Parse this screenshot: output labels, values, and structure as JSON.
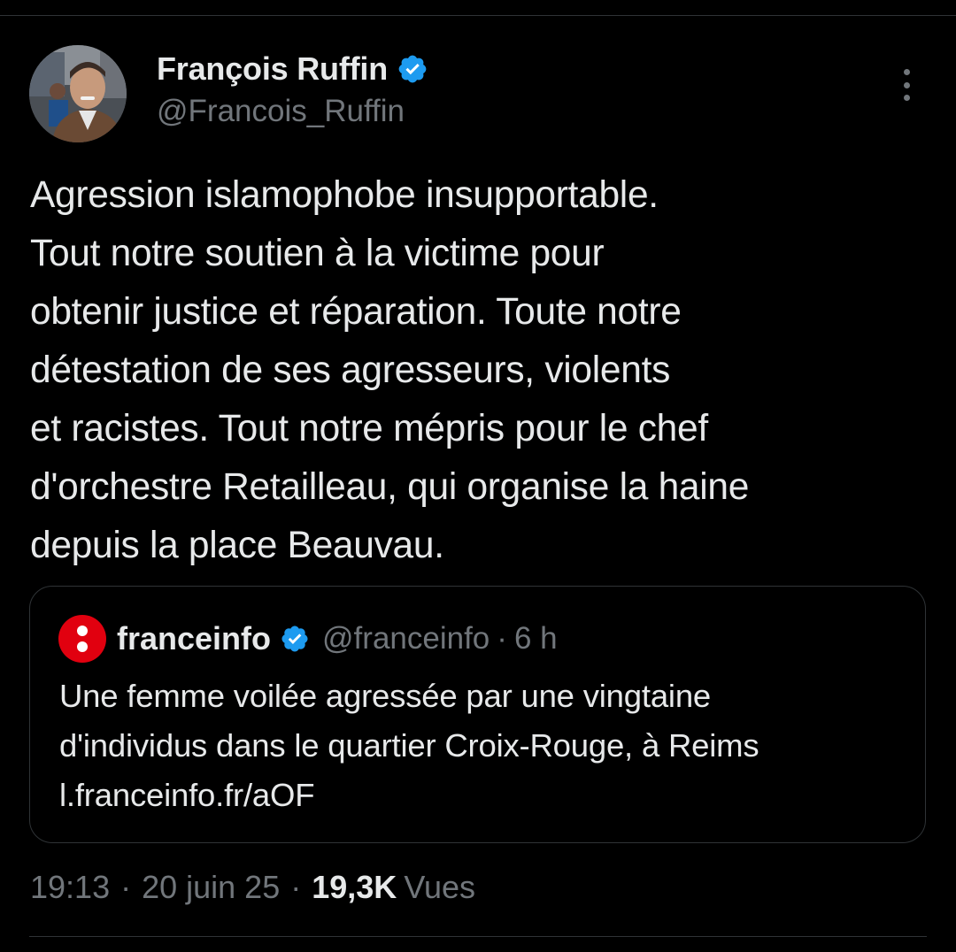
{
  "tweet": {
    "author": {
      "display_name": "François Ruffin",
      "handle": "@Francois_Ruffin",
      "verified": true
    },
    "text": "Agression islamophobe insupportable.\nTout notre soutien à la victime pour\nobtenir justice et réparation. Toute notre\ndétestation de ses agresseurs, violents\net racistes. Tout notre mépris pour le chef\nd'orchestre Retailleau, qui organise la haine\ndepuis la place Beauvau.",
    "quote": {
      "display_name": "franceinfo",
      "handle": "@franceinfo",
      "separator": "·",
      "time": "6 h",
      "text": "Une femme voilée agressée par une vingtaine\nd'individus dans le quartier Croix-Rouge, à Reims\nl.franceinfo.fr/aOF",
      "logo_color": "#e1000f"
    },
    "meta": {
      "time": "19:13",
      "sep1": "·",
      "date": "20 juin 25",
      "sep2": "·",
      "views_count": "19,3K",
      "views_label": "Vues"
    }
  },
  "colors": {
    "background": "#000000",
    "text_primary": "#e7e9ea",
    "text_secondary": "#71767b",
    "verified_blue": "#1d9bf0",
    "border": "#2f3336"
  },
  "icons": {
    "verified": "verified-badge-icon",
    "more": "more-options-icon"
  }
}
